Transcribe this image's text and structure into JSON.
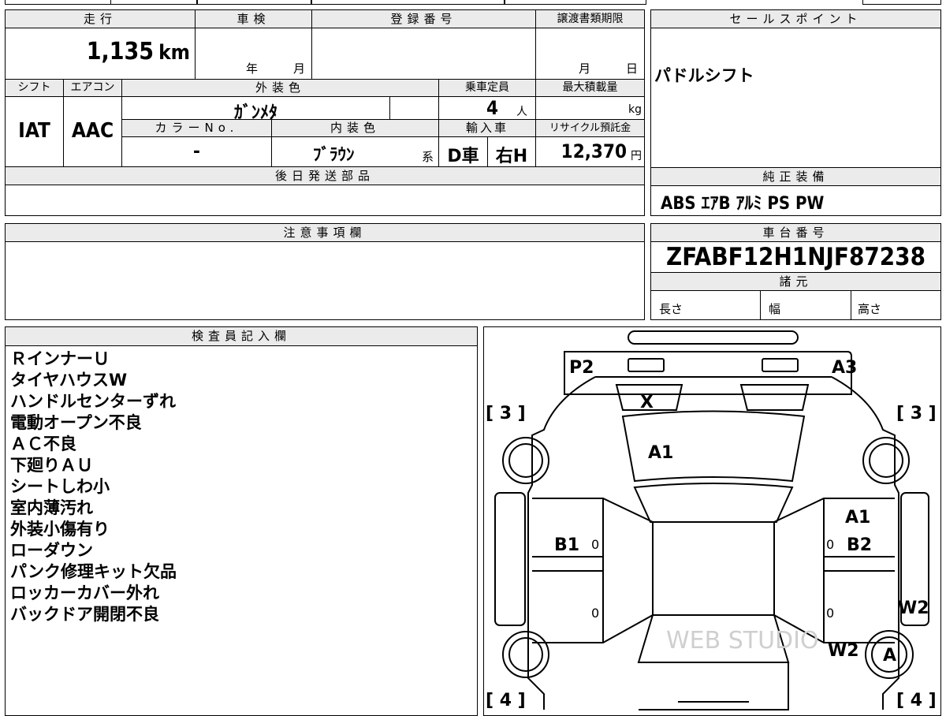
{
  "top": {
    "mileage_label": "走行",
    "mileage_value": "1,135",
    "mileage_unit": "km",
    "shaken_label": "車検",
    "shaken_year": "年",
    "shaken_month": "月",
    "reg_label": "登録番号",
    "transfer_label": "譲渡書類期限",
    "transfer_month": "月",
    "transfer_day": "日",
    "shift_label": "シフト",
    "shift_value": "IAT",
    "ac_label": "エアコン",
    "ac_value": "AAC",
    "exterior_label": "外装色",
    "exterior_value": "ｶﾞﾝﾒﾀ",
    "capacity_label": "乗車定員",
    "capacity_value": "4",
    "capacity_unit": "人",
    "load_label": "最大積載量",
    "load_unit": "kg",
    "colorno_label": "カラーNo.",
    "colorno_value": "-",
    "interior_label": "内装色",
    "interior_value": "ﾌﾞﾗｳﾝ",
    "interior_suffix": "系",
    "import_label": "輸入車",
    "import_value1": "D車",
    "import_value2": "右H",
    "recycle_label": "リサイクル預託金",
    "recycle_value": "12,370",
    "recycle_unit": "円",
    "later_parts_label": "後日発送部品"
  },
  "sales": {
    "label": "セールスポイント",
    "text": "パドルシフト"
  },
  "equipment": {
    "label": "純正装備",
    "text": "ABS ｴｱB ｱﾙﾐ PS PW"
  },
  "caution": {
    "label": "注意事項欄"
  },
  "chassis": {
    "label": "車台番号",
    "value": "ZFABF12H1NJF87238",
    "spec_label": "諸元",
    "length_label": "長さ",
    "width_label": "幅",
    "height_label": "高さ"
  },
  "inspector": {
    "label": "検査員記入欄",
    "notes": [
      "ＲインナーＵ",
      "タイヤハウスW",
      "ハンドルセンターずれ",
      "電動オープン不良",
      "ＡＣ不良",
      "下廻りＡＵ",
      "シートしわ小",
      "室内薄汚れ",
      "外装小傷有り",
      "ローダウン",
      "パンク修理キット欠品",
      "ロッカーカバー外れ",
      "バックドア開閉不良"
    ]
  },
  "diagram": {
    "p2": "P2",
    "a3": "A3",
    "x": "X",
    "a1_hood": "A1",
    "a1_right": "A1",
    "b1": "B1",
    "b2": "B2",
    "w2_right": "W2",
    "w2_rear": "W2",
    "a_rear": "A",
    "tread_fl": "[ 3 ]",
    "tread_fr": "[ 3 ]",
    "tread_rl": "[ 4 ]",
    "tread_rr": "[ 4 ]",
    "zero1": "0",
    "zero2": "0",
    "zero3": "0",
    "zero4": "0",
    "watermark": "WEB STUDIO"
  }
}
